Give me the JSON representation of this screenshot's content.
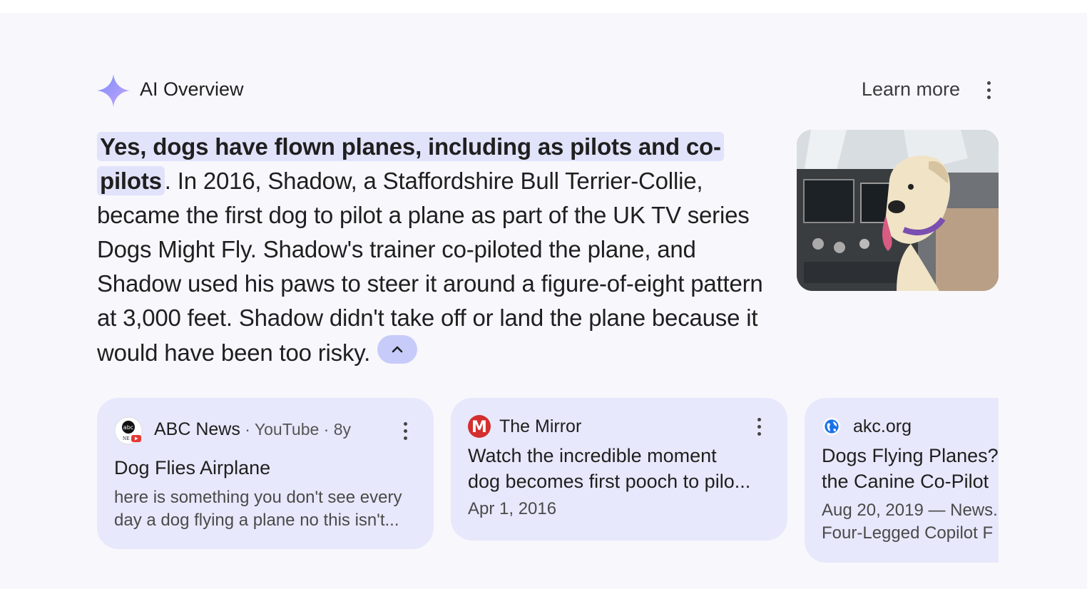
{
  "header": {
    "title": "AI Overview",
    "learn_more": "Learn more"
  },
  "answer": {
    "highlight": "Yes, dogs have flown planes, including as pilots and co-pilots",
    "body": ". In 2016, Shadow, a Staffordshire Bull Terrier-Collie, became the first dog to pilot a plane as part of the UK TV series Dogs Might Fly. Shadow's trainer co-piloted the plane, and Shadow used his paws to steer it around a fig­ure-of-eight pattern at 3,000 feet. Shadow didn't take off or land the plane because it would have been too risky."
  },
  "sources": [
    {
      "name": "ABC News",
      "meta": " · YouTube · 8y",
      "title": "Dog Flies Airplane",
      "snippet_line1": "here is something you don't see every",
      "snippet_line2": "day a dog flying a plane no this isn't..."
    },
    {
      "name": "The Mirror",
      "title_line1": "Watch the incredible moment",
      "title_line2": "dog becomes first pooch to pilo...",
      "date": "Apr 1, 2016"
    },
    {
      "name": "akc.org",
      "title_line1": "Dogs Flying Planes?",
      "title_line2": "the Canine Co-Pilot",
      "snippet_line1": "Aug 20, 2019 — News.",
      "snippet_line2": "Four-Legged Copilot F"
    }
  ],
  "icons": {
    "sparkle": "sparkle-icon",
    "more": "more-vert-icon",
    "collapse": "chevron-up-icon",
    "globe": "globe-icon"
  },
  "colors": {
    "highlight": "#e1e3fb",
    "card_bg": "#e7e8fb",
    "collapse_btn": "#c6cbf9",
    "sparkle_start": "#9b8cf7",
    "sparkle_end": "#c9b8ff"
  }
}
